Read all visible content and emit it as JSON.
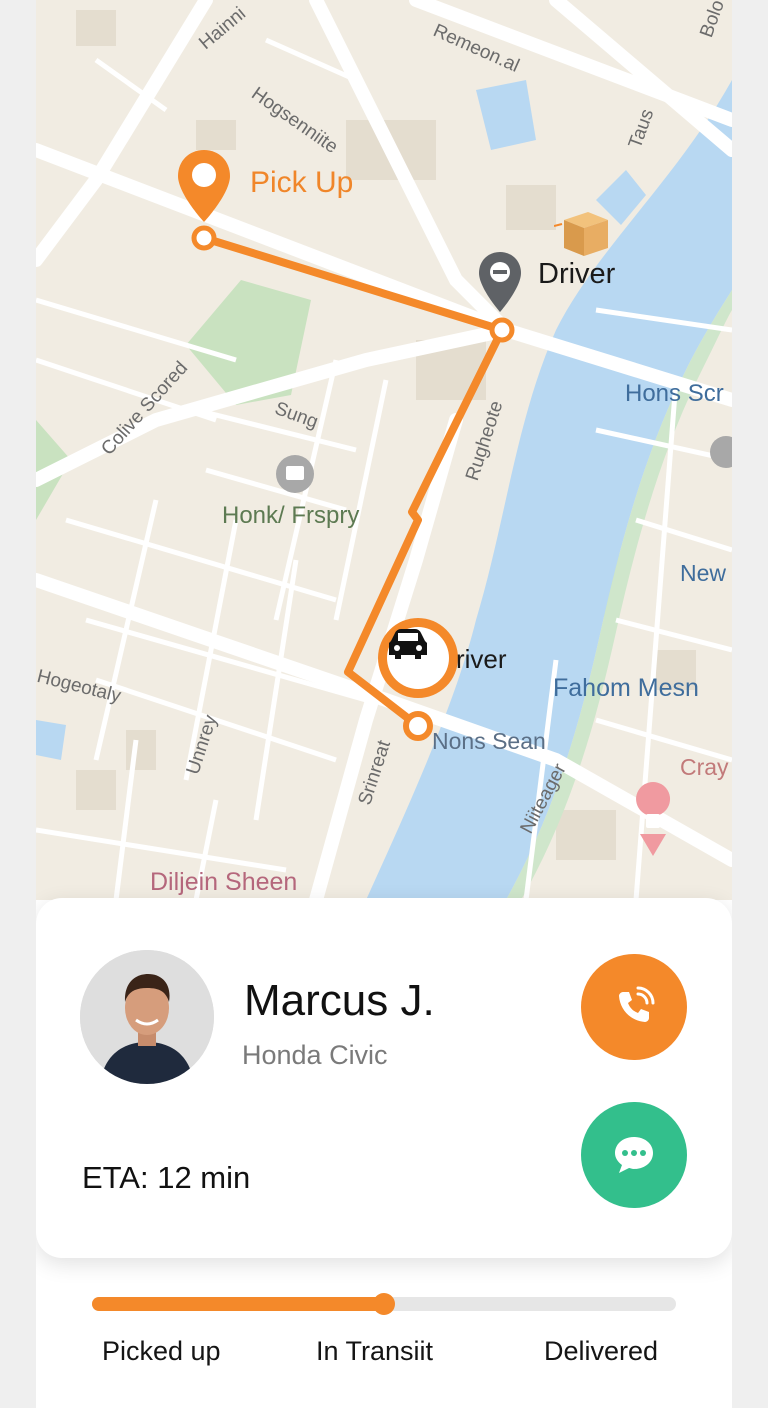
{
  "map": {
    "pickup_label": "Pick Up",
    "driver_label_top": "Driver",
    "driver_label_car": "river",
    "place_labels": [
      "Honk/ Frspry",
      "Hons Scr",
      "New",
      "Fahom Mesn",
      "Nons Sean",
      "Cray",
      "Diljein Sheen",
      "Sung"
    ],
    "street_labels": [
      "Hainni",
      "Hogsenniite",
      "Remeon.al",
      "Taus",
      "Colive Scored",
      "Rugheote",
      "Hogeotaly",
      "Unnrey",
      "Srinreat",
      "Niiteager",
      "Bolo"
    ]
  },
  "driver": {
    "name": "Marcus J.",
    "vehicle": "Honda Civic",
    "eta": "ETA: 12 min"
  },
  "progress": {
    "fraction": 0.5,
    "steps": [
      "Picked up",
      "In Transiit",
      "Delivered"
    ]
  },
  "colors": {
    "accent": "#f4892a",
    "chat": "#33bf8c",
    "water": "#b8d8f2",
    "park": "#c9e2c0"
  },
  "icons": {
    "call": "phone-ringing-icon",
    "chat": "chat-bubble-icon",
    "car": "car-icon",
    "pickup": "map-pin-icon",
    "driver": "driver-pin-icon",
    "package": "package-icon"
  }
}
